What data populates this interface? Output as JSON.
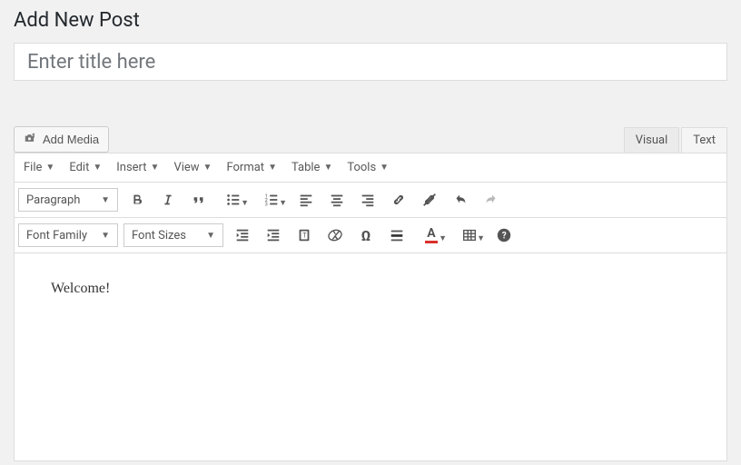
{
  "page": {
    "title": "Add New Post"
  },
  "title_input": {
    "placeholder": "Enter title here",
    "value": ""
  },
  "add_media": {
    "label": "Add Media"
  },
  "tabs": {
    "visual": "Visual",
    "text": "Text"
  },
  "menubar": {
    "file": "File",
    "edit": "Edit",
    "insert": "Insert",
    "view": "View",
    "format": "Format",
    "table": "Table",
    "tools": "Tools"
  },
  "toolbar1": {
    "paragraph": "Paragraph"
  },
  "toolbar2": {
    "font_family": "Font Family",
    "font_sizes": "Font Sizes"
  },
  "content": {
    "text": "Welcome!"
  }
}
